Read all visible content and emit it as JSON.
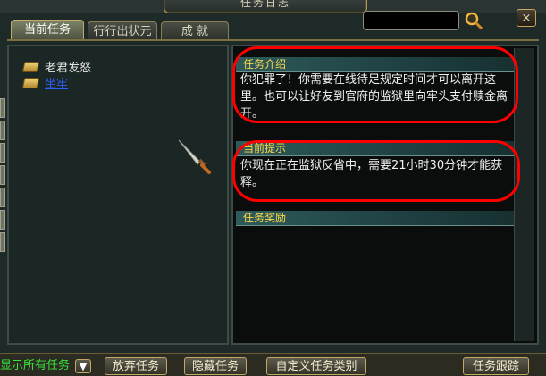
{
  "window": {
    "title": "任务日志",
    "close_label": "×"
  },
  "tabs": [
    {
      "label": "当前任务",
      "active": true
    },
    {
      "label": "行行出状元",
      "active": false
    },
    {
      "label": "成  就",
      "active": false
    }
  ],
  "quests": [
    {
      "label": "老君发怒",
      "selected": false
    },
    {
      "label": "坐牢",
      "selected": true
    }
  ],
  "details": {
    "intro_title": "任务介绍",
    "intro_text": "你犯罪了！你需要在线待足规定时间才可以离开这里。也可以让好友到官府的监狱里向牢头支付赎金离开。",
    "hint_title": "当前提示",
    "hint_text": "你现在正在监狱反省中，需要21小时30分钟才能获释。",
    "reward_title": "任务奖励"
  },
  "bottom": {
    "show_all_label": "显示所有任务",
    "abandon_label": "放弃任务",
    "hide_label": "隐藏任务",
    "custom_category_label": "自定义任务类别",
    "track_label": "任务跟踪"
  },
  "colors": {
    "section_title": "#ffd84a",
    "selected_quest": "#2f5fff",
    "show_all": "#38e63c",
    "annotation": "#ff0000"
  }
}
